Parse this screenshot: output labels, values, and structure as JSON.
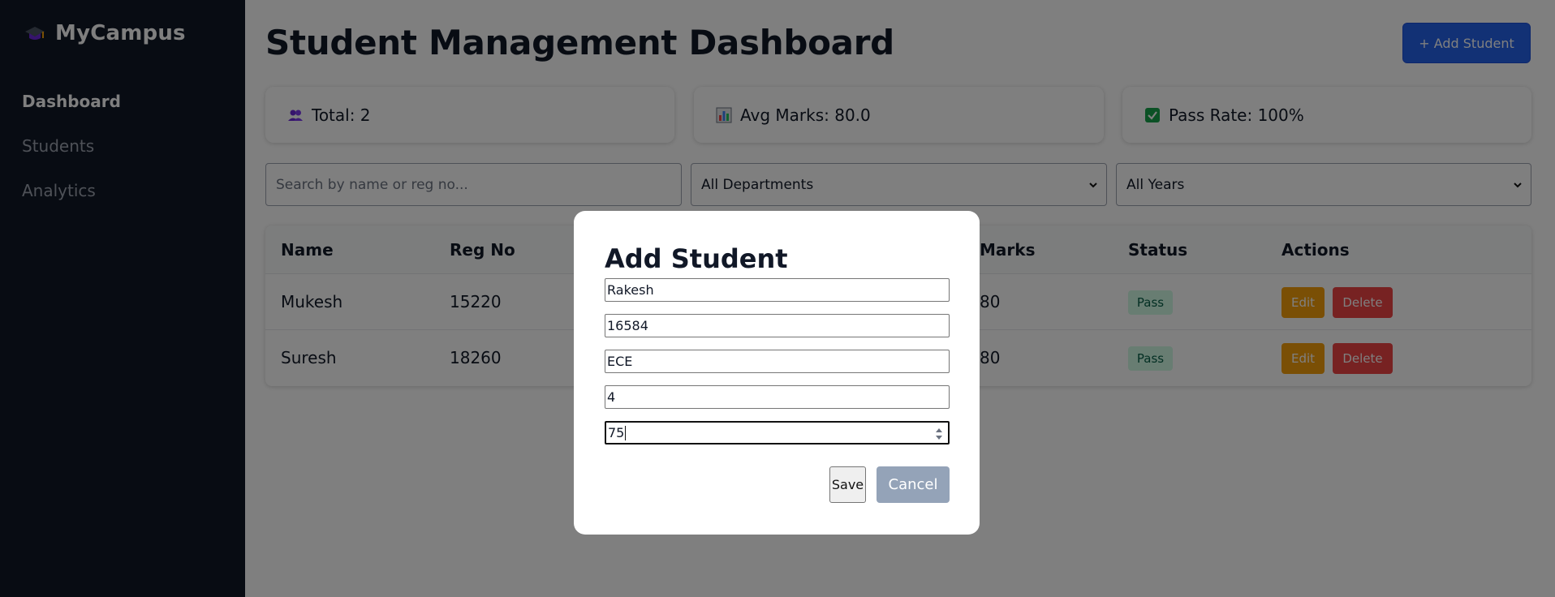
{
  "sidebar": {
    "brand": "MyCampus",
    "items": [
      {
        "label": "Dashboard",
        "active": true
      },
      {
        "label": "Students",
        "active": false
      },
      {
        "label": "Analytics",
        "active": false
      }
    ]
  },
  "header": {
    "title": "Student Management Dashboard",
    "add_button": "+ Add Student"
  },
  "stats": [
    {
      "icon": "users-icon",
      "label": "Total: 2"
    },
    {
      "icon": "bar-chart-icon",
      "label": "Avg Marks: 80.0"
    },
    {
      "icon": "check-icon",
      "label": "Pass Rate: 100%"
    }
  ],
  "filters": {
    "search_placeholder": "Search by name or reg no...",
    "department": "All Departments",
    "year": "All Years"
  },
  "table": {
    "headers": [
      "Name",
      "Reg No",
      "Marks",
      "Status",
      "Actions"
    ],
    "rows": [
      {
        "name": "Mukesh",
        "reg": "15220",
        "marks": "80",
        "status": "Pass",
        "edit": "Edit",
        "delete": "Delete"
      },
      {
        "name": "Suresh",
        "reg": "18260",
        "marks": "80",
        "status": "Pass",
        "edit": "Edit",
        "delete": "Delete"
      }
    ]
  },
  "modal": {
    "title": "Add Student",
    "fields": [
      "Rakesh",
      "16584",
      "ECE",
      "4",
      "75"
    ],
    "save": "Save",
    "cancel": "Cancel"
  },
  "colors": {
    "sidebar_bg": "#111827",
    "primary": "#2563eb",
    "edit": "#f59e0b",
    "delete": "#ef4444",
    "pass_badge": "#d1fae5",
    "cancel": "#94a3b8"
  }
}
